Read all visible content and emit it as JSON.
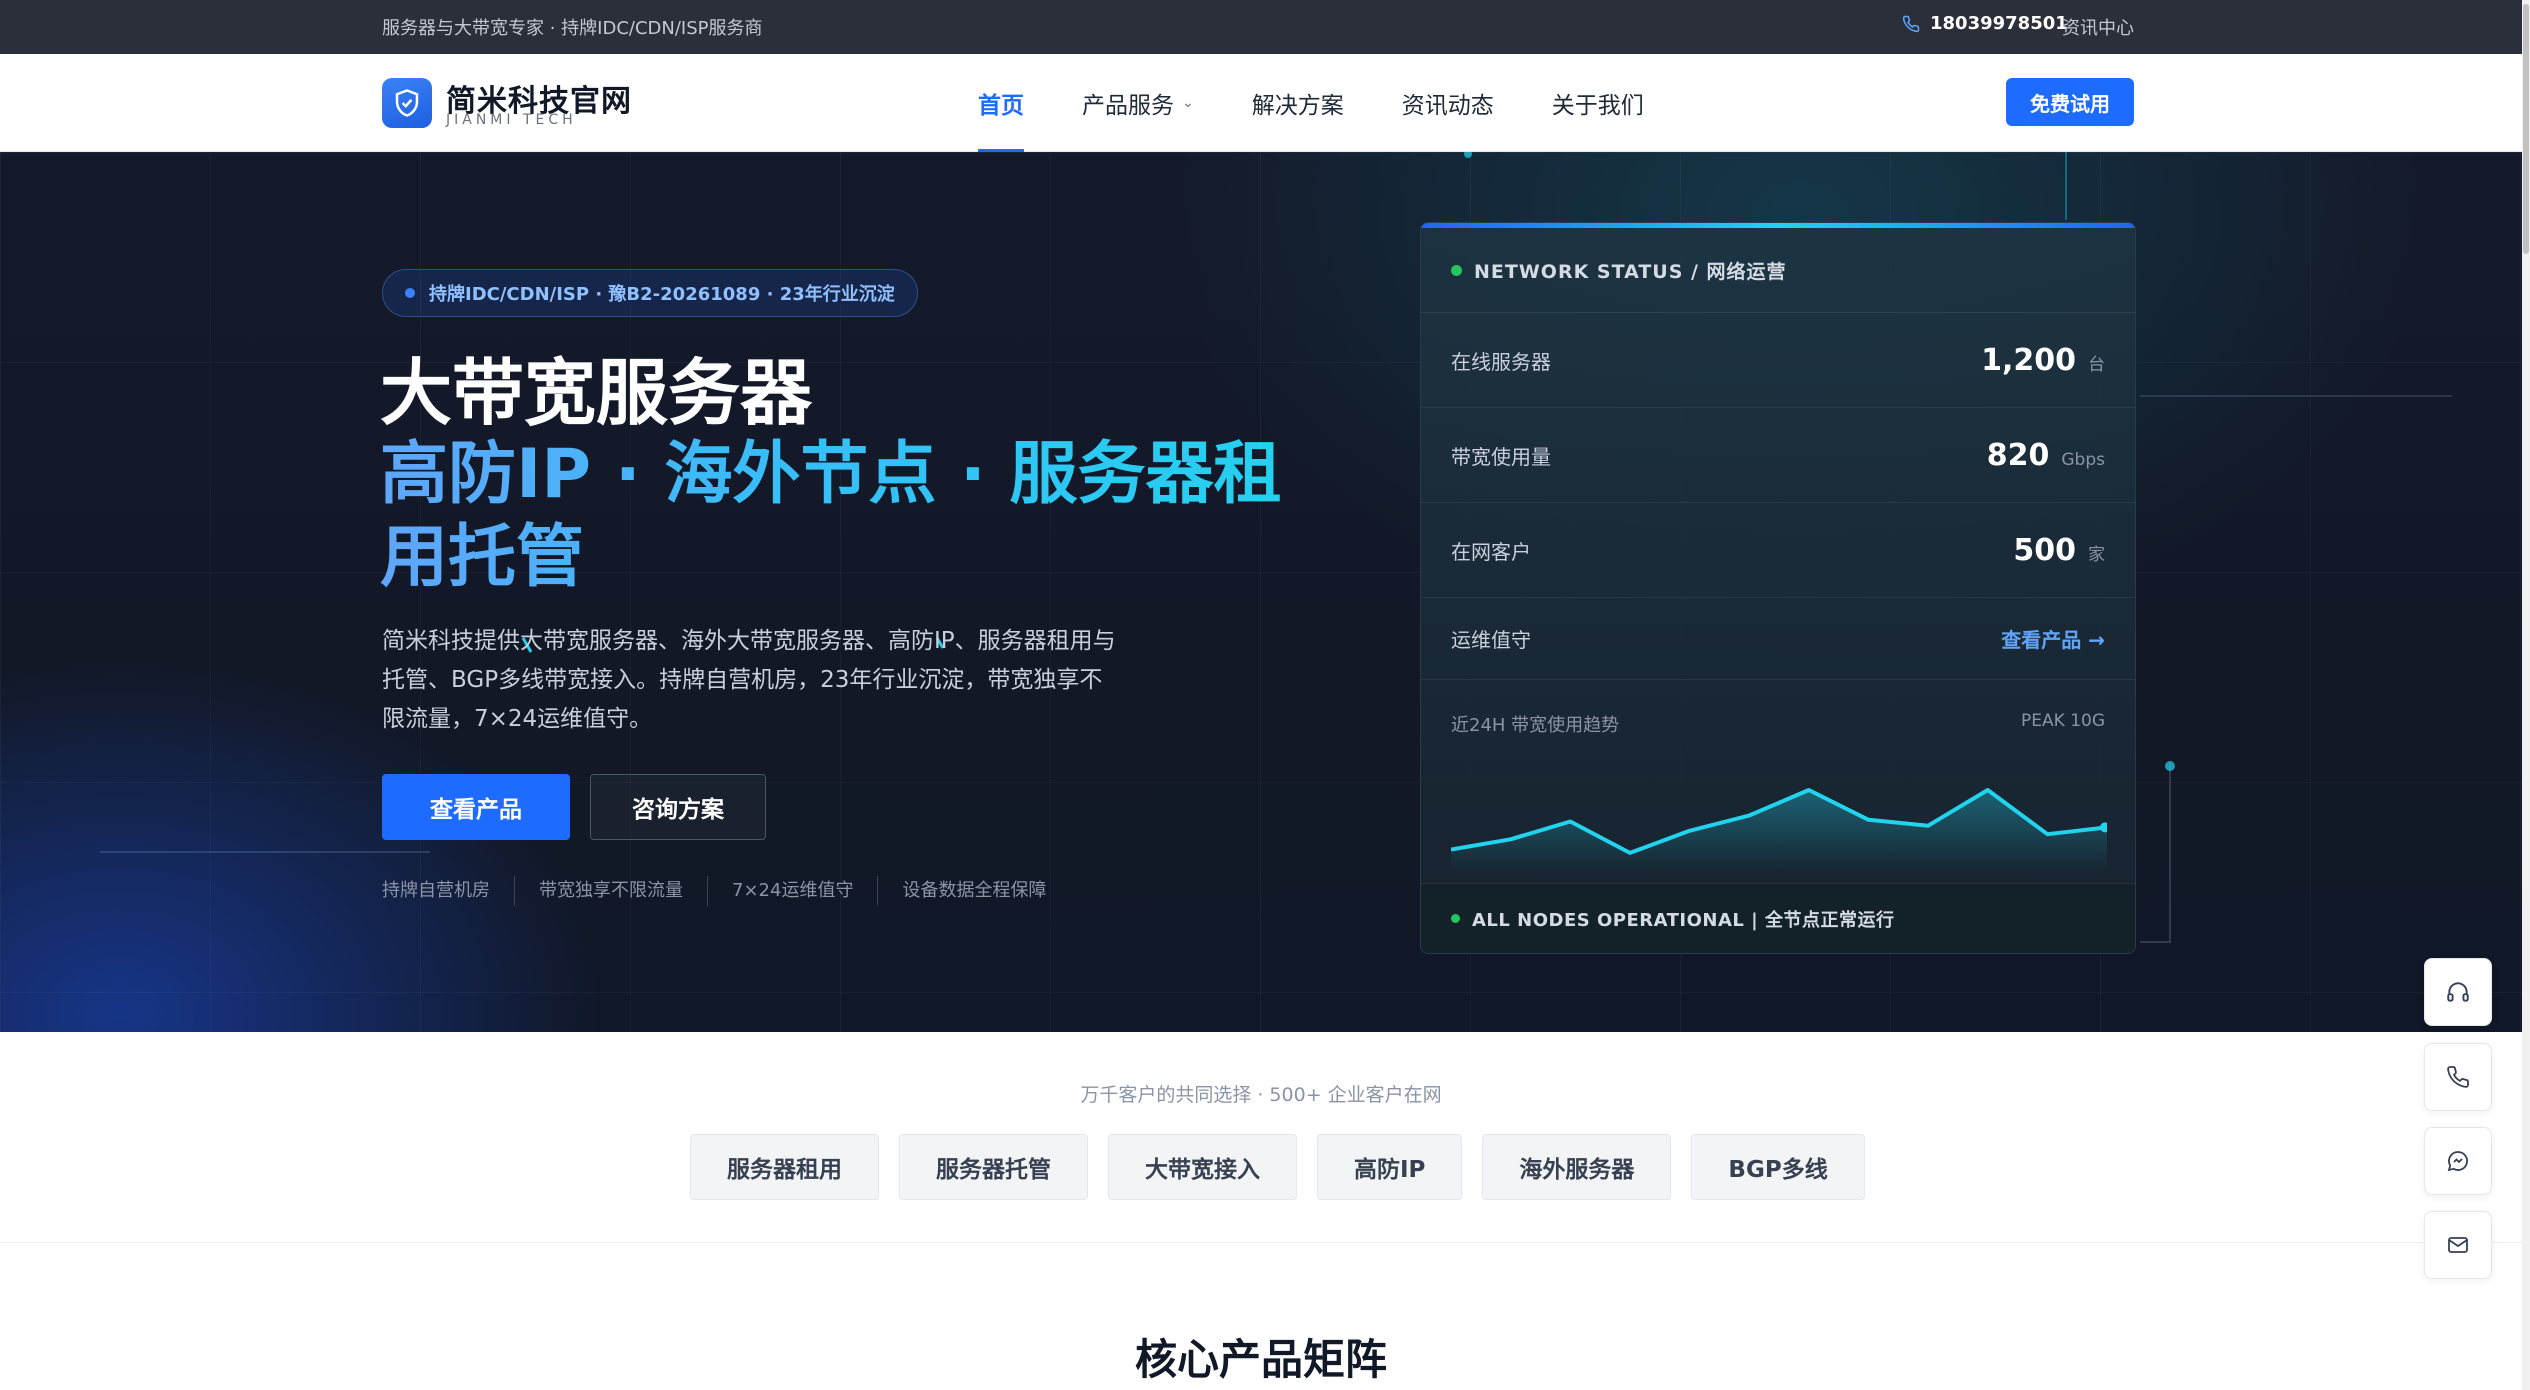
{
  "topbar": {
    "tagline": "服务器与大带宽专家 · 持牌IDC/CDN/ISP服务商",
    "phone": "18039978501",
    "news_link": "资讯中心"
  },
  "brand": {
    "name": "简米科技官网",
    "subtitle": "JIANMI TECH"
  },
  "nav": {
    "items": [
      {
        "label": "首页"
      },
      {
        "label": "产品服务"
      },
      {
        "label": "解决方案"
      },
      {
        "label": "资讯动态"
      },
      {
        "label": "关于我们"
      }
    ],
    "trial_button": "免费试用"
  },
  "hero": {
    "badge": "持牌IDC/CDN/ISP · 豫B2-20261089 · 23年行业沉淀",
    "title": "大带宽服务器",
    "subtitle": "高防IP · 海外节点 · 服务器租用托管",
    "description": "简米科技提供大带宽服务器、海外大带宽服务器、高防IP、服务器租用与托管、BGP多线带宽接入。持牌自营机房，23年行业沉淀，带宽独享不限流量，7×24运维值守。",
    "primary_button": "查看产品",
    "secondary_button": "咨询方案",
    "features": [
      "持牌自营机房",
      "带宽独享不限流量",
      "7×24运维值守",
      "设备数据全程保障"
    ]
  },
  "status_card": {
    "header": "NETWORK STATUS / 网络运营",
    "rows": [
      {
        "label": "在线服务器",
        "value": "1,200",
        "unit": "台"
      },
      {
        "label": "带宽使用量",
        "value": "820",
        "unit": "Gbps"
      },
      {
        "label": "在网客户",
        "value": "500",
        "unit": "家"
      }
    ],
    "ops_label": "运维值守",
    "ops_link": "查看产品 →",
    "trend_label": "近24H 带宽使用趋势",
    "trend_peak": "PEAK 10G",
    "trend_values": [
      0.1,
      0.22,
      0.43,
      0.06,
      0.32,
      0.5,
      0.8,
      0.45,
      0.38,
      0.8,
      0.28,
      0.36
    ],
    "footer": "ALL NODES OPERATIONAL | 全节点正常运行",
    "accent": "#22d3ee",
    "status_color": "#22c55e"
  },
  "clients": {
    "caption": "万千客户的共同选择 · 500+ 企业客户在网",
    "chips": [
      "服务器租用",
      "服务器托管",
      "大带宽接入",
      "高防IP",
      "海外服务器",
      "BGP多线"
    ]
  },
  "section": {
    "title": "核心产品矩阵"
  },
  "side_tools": [
    "headset-icon",
    "phone-icon",
    "chat-icon",
    "mail-icon"
  ],
  "colors": {
    "brand_blue": "#1d6bff",
    "hero_bg": "#141a2a",
    "topbar_bg": "#2b2f3a"
  }
}
